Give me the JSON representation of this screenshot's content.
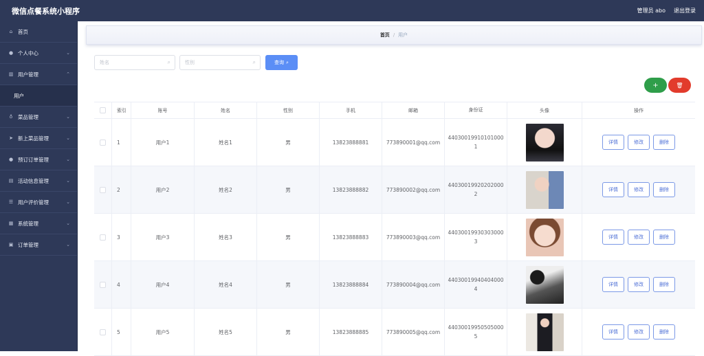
{
  "header": {
    "app_title": "微信点餐系统小程序",
    "admin_label": "管理员 abo",
    "logout_label": "退出登录"
  },
  "sidebar": {
    "items": [
      {
        "label": "首页",
        "icon": "home-icon",
        "has_chevron": false
      },
      {
        "label": "个人中心",
        "icon": "user-icon",
        "has_chevron": true
      },
      {
        "label": "用户管理",
        "icon": "chart-icon",
        "has_chevron": true,
        "expanded": true
      },
      {
        "label": "菜品管理",
        "icon": "mic-icon",
        "has_chevron": true
      },
      {
        "label": "新上菜品管理",
        "icon": "send-icon",
        "has_chevron": true
      },
      {
        "label": "预订订单管理",
        "icon": "user-icon",
        "has_chevron": true
      },
      {
        "label": "活动信息管理",
        "icon": "message-icon",
        "has_chevron": true
      },
      {
        "label": "用户评价管理",
        "icon": "list-icon",
        "has_chevron": true
      },
      {
        "label": "系统管理",
        "icon": "grid-icon",
        "has_chevron": true
      },
      {
        "label": "订单管理",
        "icon": "doc-icon",
        "has_chevron": true
      }
    ],
    "submenu_user": "用户"
  },
  "breadcrumb": {
    "home": "首页",
    "separator": "/",
    "current": "用户"
  },
  "search": {
    "name_placeholder": "姓名",
    "sex_placeholder": "性别",
    "query_label": "查询"
  },
  "actions": {
    "add_symbol": "+",
    "delete_symbol": "🗑"
  },
  "table": {
    "headers": [
      "索引",
      "账号",
      "姓名",
      "性别",
      "手机",
      "邮箱",
      "身份证",
      "头像",
      "操作"
    ],
    "rows": [
      {
        "index": "1",
        "account": "用户1",
        "name": "姓名1",
        "sex": "男",
        "phone": "13823888881",
        "email": "773890001@qq.com",
        "idcard": "440300199101010001"
      },
      {
        "index": "2",
        "account": "用户2",
        "name": "姓名2",
        "sex": "男",
        "phone": "13823888882",
        "email": "773890002@qq.com",
        "idcard": "440300199202020002"
      },
      {
        "index": "3",
        "account": "用户3",
        "name": "姓名3",
        "sex": "男",
        "phone": "13823888883",
        "email": "773890003@qq.com",
        "idcard": "440300199303030003"
      },
      {
        "index": "4",
        "account": "用户4",
        "name": "姓名4",
        "sex": "男",
        "phone": "13823888884",
        "email": "773890004@qq.com",
        "idcard": "440300199404040004"
      },
      {
        "index": "5",
        "account": "用户5",
        "name": "姓名5",
        "sex": "男",
        "phone": "13823888885",
        "email": "773890005@qq.com",
        "idcard": "440300199505050005"
      }
    ],
    "op_detail": "详情",
    "op_edit": "修改",
    "op_delete": "删除"
  },
  "colors": {
    "sidebar_bg": "#2e3958",
    "primary": "#5b8ef6",
    "add": "#2f9e4a",
    "danger": "#e23b2c"
  }
}
